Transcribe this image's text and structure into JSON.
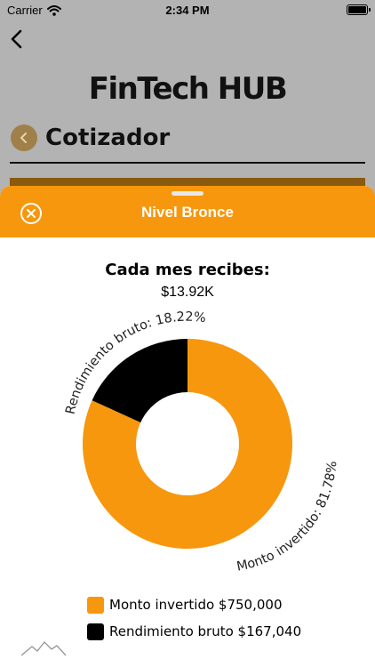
{
  "status_bar": {
    "carrier": "Carrier",
    "time": "2:34 PM"
  },
  "background": {
    "logo": "FinTech HUB",
    "page_title": "Cotizador"
  },
  "sheet": {
    "title": "Nivel Bronce",
    "accent_color": "#f7970d",
    "monthly_label": "Cada mes recibes:",
    "monthly_value": "$13.92K"
  },
  "chart_data": {
    "type": "pie",
    "donut": true,
    "series": [
      {
        "name": "Monto invertido",
        "value": 750000,
        "percent": 81.78,
        "color": "#f7970d"
      },
      {
        "name": "Rendimiento bruto",
        "value": 167040,
        "percent": 18.22,
        "color": "#000000"
      }
    ],
    "slice_labels": [
      "Monto invertido: 81.78%",
      "Rendimiento bruto: 18.22%"
    ],
    "legend": [
      {
        "label": "Monto invertido $750,000",
        "color": "#f7970d"
      },
      {
        "label": "Rendimiento bruto $167,040",
        "color": "#000000"
      }
    ]
  },
  "icons": [
    "wifi-icon",
    "battery-icon",
    "chevron-left-icon",
    "close-circle-icon",
    "mountain-logo-icon"
  ]
}
